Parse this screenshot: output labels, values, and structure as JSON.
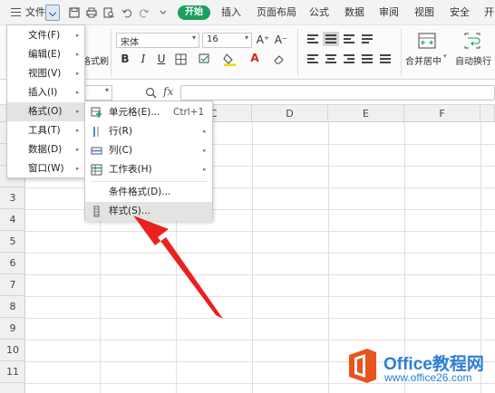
{
  "menubar": {
    "file_label": "文件",
    "start_label": "开始",
    "tabs": [
      "插入",
      "页面布局",
      "公式",
      "数据",
      "审阅",
      "视图",
      "安全",
      "开"
    ]
  },
  "ribbon": {
    "font_name": "宋体",
    "font_size": "16",
    "format_painter_partial": "格式刷",
    "merge_center": "合并居中",
    "auto_wrap": "自动换行",
    "bold": "B",
    "italic": "I",
    "underline": "U",
    "grow_font": "A⁺",
    "shrink_font": "A⁻",
    "font_color_glyph": "A"
  },
  "formula_bar": {
    "fx_label": "fx"
  },
  "grid": {
    "columns": [
      "C",
      "D",
      "E",
      "F"
    ],
    "rows": [
      "3",
      "4",
      "5",
      "6",
      "7",
      "8",
      "9",
      "10",
      "11"
    ]
  },
  "main_menu": {
    "items": [
      {
        "label": "文件(F)"
      },
      {
        "label": "编辑(E)"
      },
      {
        "label": "视图(V)"
      },
      {
        "label": "插入(I)"
      },
      {
        "label": "格式(O)"
      },
      {
        "label": "工具(T)"
      },
      {
        "label": "数据(D)"
      },
      {
        "label": "窗口(W)"
      }
    ]
  },
  "format_submenu": {
    "items": [
      {
        "label": "单元格(E)...",
        "shortcut": "Ctrl+1"
      },
      {
        "label": "行(R)"
      },
      {
        "label": "列(C)"
      },
      {
        "label": "工作表(H)"
      },
      {
        "label": "条件格式(D)..."
      },
      {
        "label": "样式(S)..."
      }
    ]
  },
  "watermark": {
    "name": "Office教程网",
    "url": "www.office26.com"
  },
  "colors": {
    "start_green": "#1ba05b",
    "arrow_red": "#e8221f",
    "watermark_orange": "#e8531e",
    "watermark_blue": "#2d7fd2"
  }
}
